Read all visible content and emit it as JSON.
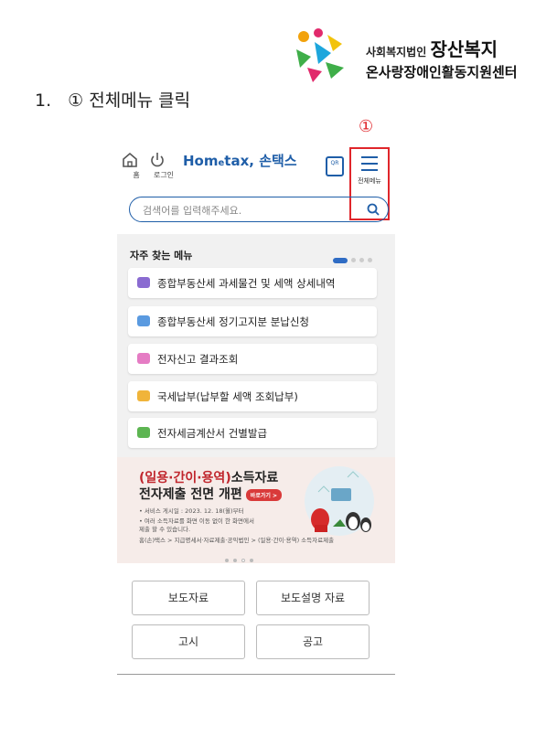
{
  "org": {
    "line1_small": "사회복지법인",
    "line1_big": "장산복지",
    "line2": "온사랑장애인활동지원센터"
  },
  "instruction": {
    "number": "1.",
    "text": "① 전체메뉴 클릭"
  },
  "marker": "①",
  "header": {
    "home_label": "홈",
    "login_label": "로그인",
    "logo_hom": "Hom",
    "logo_e": "e",
    "logo_tax": "tax,",
    "logo_kr": "손택스",
    "qr_label": "QR",
    "menu_label": "전체메뉴"
  },
  "search": {
    "placeholder": "검색어를 입력해주세요."
  },
  "favorites": {
    "title": "자주 찾는 메뉴",
    "items": [
      {
        "label": "종합부동산세 과세물건 및 세액 상세내역",
        "color": "#8a6bd1"
      },
      {
        "label": "종합부동산세 정기고지분 분납신청",
        "color": "#5a9ae0"
      },
      {
        "label": "전자신고 결과조회",
        "color": "#e57cc4"
      },
      {
        "label": "국세납부(납부할 세액 조회납부)",
        "color": "#f0b43a"
      },
      {
        "label": "전자세금계산서 건별발급",
        "color": "#5db552"
      }
    ]
  },
  "banner": {
    "title_hl": "(일용·간이·용역)",
    "title_rest": "소득자료",
    "line2": "전자제출 전면 개편",
    "pill": "바로가기 >",
    "date": "• 서비스 게시일 : 2023. 12. 18(월)부터",
    "note1": "• 여러 소득자료를 화면 이동 없이 한 화면에서",
    "note2": "제출 할 수 있습니다.",
    "path": "홈(손)택스 > 지급명세서·자료제출·공익법인 > (일용·간이·용역) 소득자료제출"
  },
  "buttons": {
    "press": "보도자료",
    "press_explain": "보도설명 자료",
    "notice": "고시",
    "announce": "공고"
  },
  "colors": {
    "accent": "#1f5ea8",
    "highlight": "#e0262b"
  }
}
